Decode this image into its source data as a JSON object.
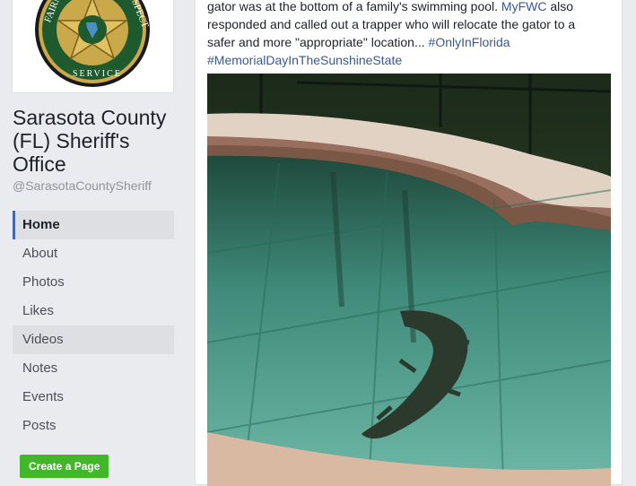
{
  "page": {
    "title": "Sarasota County (FL) Sheriff's Office",
    "handle": "@SarasotaCountySheriff"
  },
  "nav": {
    "items": [
      "Home",
      "About",
      "Photos",
      "Likes",
      "Videos",
      "Notes",
      "Events",
      "Posts"
    ]
  },
  "create_page_button": "Create a Page",
  "post": {
    "line1": "gator was at the bottom of a family's swimming pool.",
    "link_myfwc": "MyFWC",
    "line1_tail": "also",
    "line2": "responded and called out a trapper who will relocate the gator to a",
    "line3": "safer and more \"appropriate\" location...",
    "hashtag1": "#OnlyInFlorida",
    "hashtag2": "#MemorialDayInTheSunshineState"
  },
  "badge": {
    "text_left": "FAIRNE",
    "text_right": "SPECT",
    "text_bottom": "SERVICE"
  },
  "colors": {
    "link": "#365899",
    "nav_accent": "#4267b2",
    "create_button": "#42b72a",
    "badge_green": "#1f5a2e",
    "badge_gold": "#c9a94a"
  }
}
